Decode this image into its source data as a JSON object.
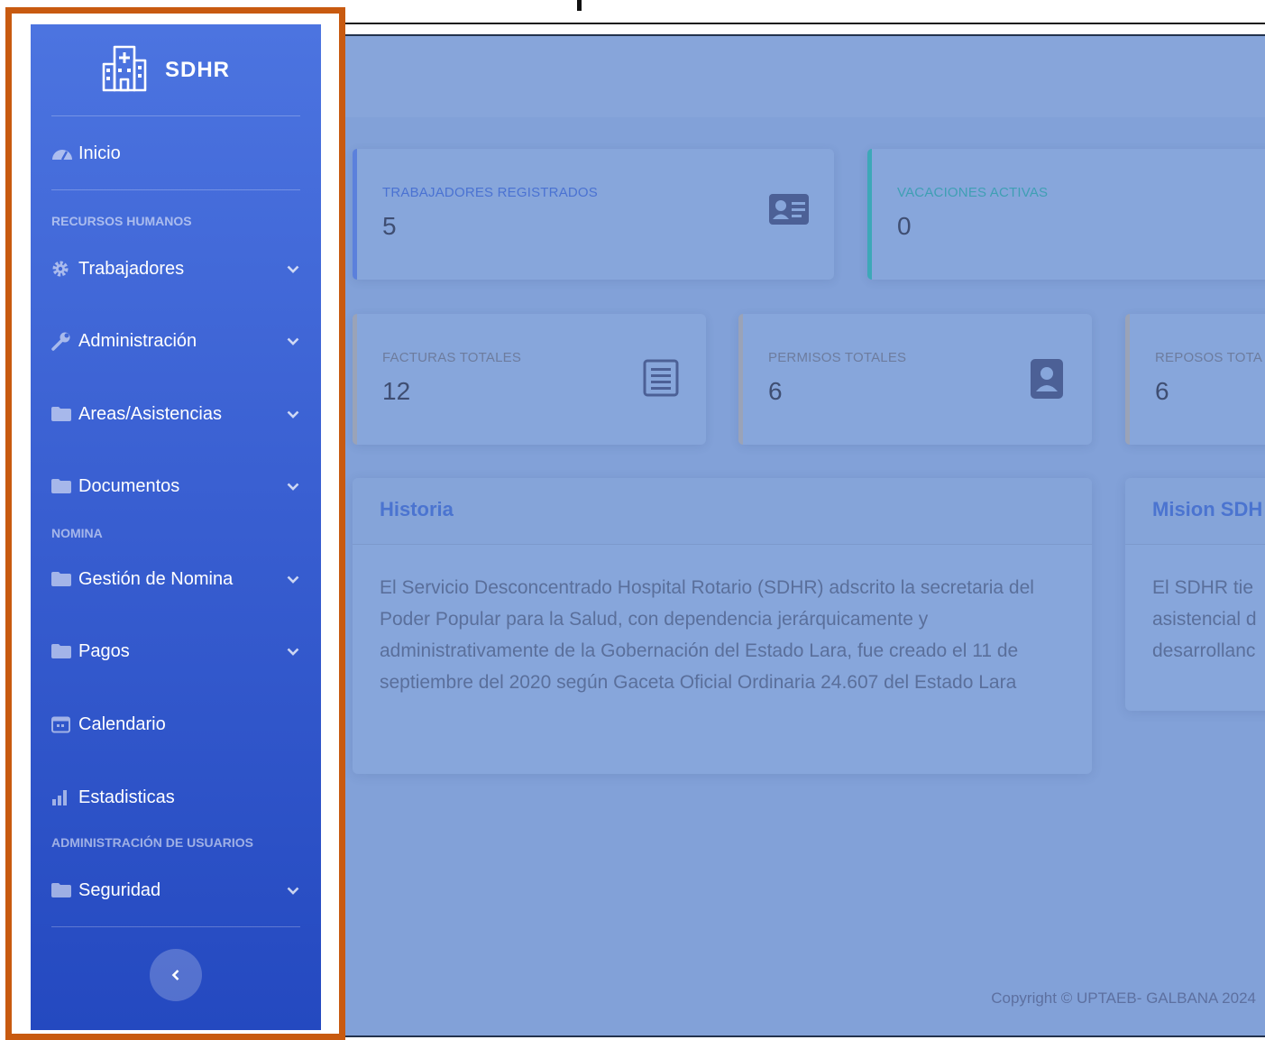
{
  "brand": {
    "name": "SDHR",
    "logo_icon": "hospital-icon"
  },
  "sidebar": {
    "dashboard": {
      "label": "Inicio",
      "icon": "tachometer-icon"
    },
    "headings": {
      "hr": "RECURSOS HUMANOS",
      "payroll": "NOMINA",
      "users": "ADMINISTRACIÓN DE USUARIOS"
    },
    "items": {
      "trabajadores": {
        "label": "Trabajadores",
        "icon": "cog-icon"
      },
      "administracion": {
        "label": "Administración",
        "icon": "wrench-icon"
      },
      "areas": {
        "label": "Areas/Asistencias",
        "icon": "folder-icon"
      },
      "documentos": {
        "label": "Documentos",
        "icon": "folder-icon"
      },
      "gestion": {
        "label": "Gestión de Nomina",
        "icon": "folder-icon"
      },
      "pagos": {
        "label": "Pagos",
        "icon": "folder-icon"
      },
      "calendario": {
        "label": "Calendario",
        "icon": "calendar-icon"
      },
      "estadisticas": {
        "label": "Estadisticas",
        "icon": "bar-chart-icon"
      },
      "seguridad": {
        "label": "Seguridad",
        "icon": "folder-icon"
      }
    },
    "toggle_icon": "chevron-left-icon"
  },
  "stats": {
    "workers": {
      "label": "TRABAJADORES REGISTRADOS",
      "value": "5",
      "color": "#4e73df"
    },
    "vacations": {
      "label": "VACACIONES ACTIVAS",
      "value": "0",
      "color": "#36b9cc"
    },
    "invoices": {
      "label": "FACTURAS TOTALES",
      "value": "12",
      "color": "#a0a8b8"
    },
    "permits": {
      "label": "PERMISOS TOTALES",
      "value": "6",
      "color": "#a0a8b8"
    },
    "rests": {
      "label": "REPOSOS TOTA",
      "value": "6",
      "color": "#a0a8b8"
    }
  },
  "historia": {
    "title": "Historia",
    "body": "El Servicio Desconcentrado Hospital Rotario (SDHR) adscrito la secretaria del Poder Popular para la Salud, con dependencia jerárquicamente y administrativamente de la Gobernación del Estado Lara, fue creado el 11 de septiembre del 2020 según Gaceta Oficial Ordinaria 24.607 del Estado Lara"
  },
  "mision": {
    "title": "Mision SDH",
    "lines": [
      "El SDHR tie",
      "asistencial d",
      "desarrollanc"
    ]
  },
  "footer": {
    "copyright": "Copyright © UPTAEB- GALBANA 2024"
  }
}
